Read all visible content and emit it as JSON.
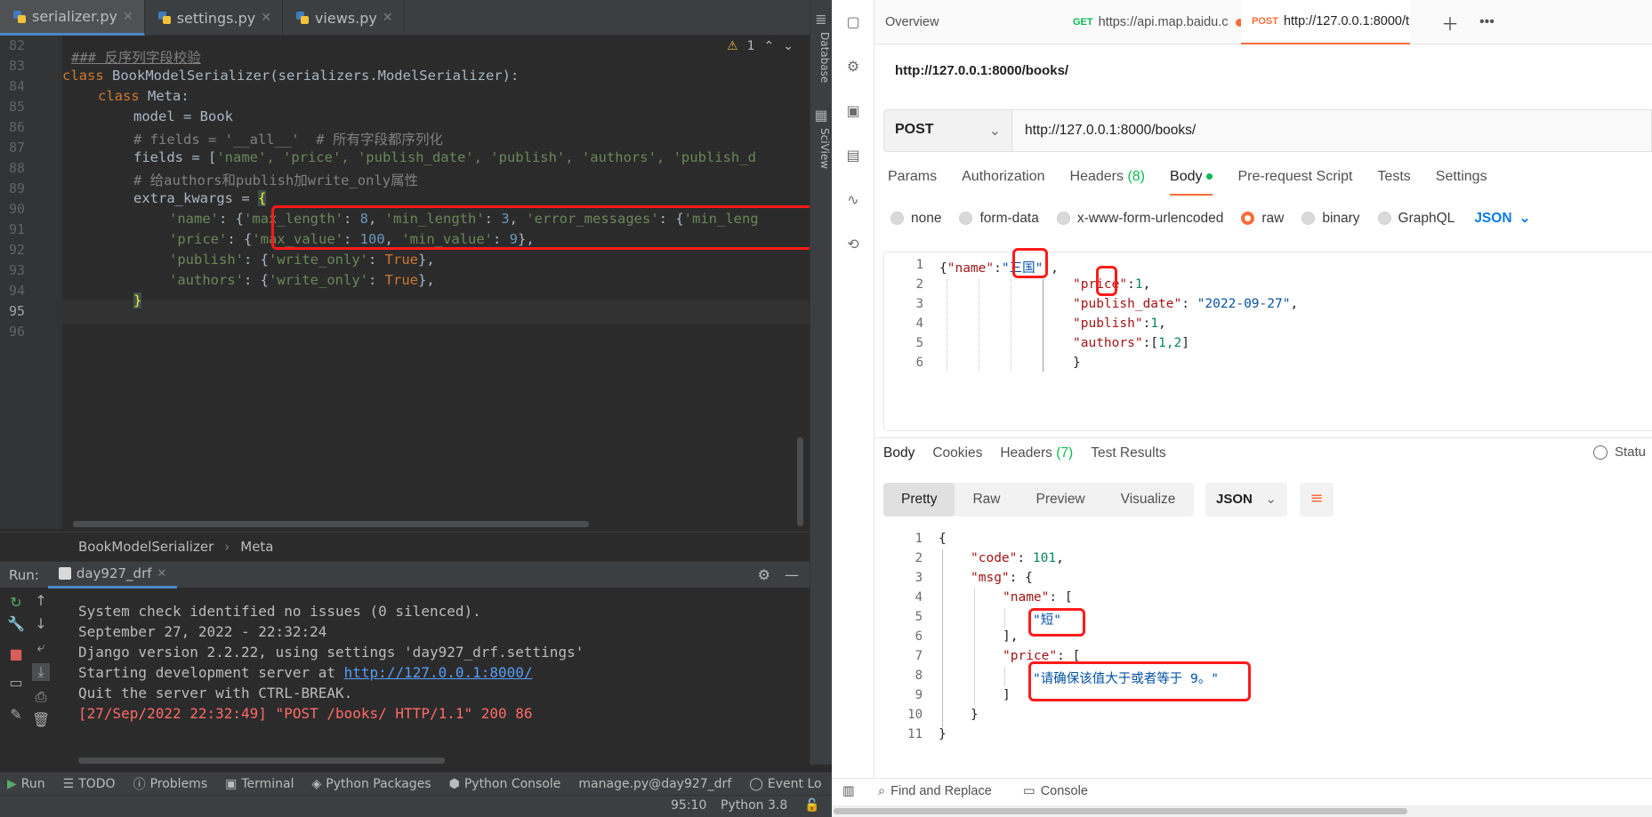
{
  "ide": {
    "tabs": [
      {
        "label": "serializer.py"
      },
      {
        "label": "settings.py"
      },
      {
        "label": "views.py"
      }
    ],
    "tool_windows": {
      "database": "Database",
      "sciview": "SciView"
    },
    "inspection": {
      "warnings": "1"
    },
    "line_numbers": [
      "82",
      "83",
      "84",
      "85",
      "86",
      "87",
      "88",
      "89",
      "90",
      "91",
      "92",
      "93",
      "94",
      "95",
      "96"
    ],
    "code": {
      "l83_comment": "### 反序列字段校验",
      "l84_kw": "class",
      "l84_name": "BookModelSerializer",
      "l84_rest": "(serializers.ModelSerializer):",
      "l85_kw": "class",
      "l85_name": " Meta:",
      "l86": "model = Book",
      "l87": "# fields = '__all__'  # 所有字段都序列化",
      "l88_a": "fields = [",
      "l88_b": "'name', 'price', 'publish_date', 'publish', 'authors', 'publish_d",
      "l89": "# 给authors和publish加write_only属性",
      "l90_a": "extra_kwargs = ",
      "l90_b": "{",
      "l91_a": "'name'",
      "l91_b": ": {",
      "l91_c": "'max_length'",
      "l91_d": ": ",
      "l91_e": "8",
      "l91_f": ", ",
      "l91_g": "'min_length'",
      "l91_h": ": ",
      "l91_i": "3",
      "l91_j": ", ",
      "l91_k": "'error_messages'",
      "l91_l": ": {",
      "l91_m": "'min_leng",
      "l92_a": "'price'",
      "l92_b": ": {",
      "l92_c": "'max_value'",
      "l92_d": ": ",
      "l92_e": "100",
      "l92_f": ", ",
      "l92_g": "'min_value'",
      "l92_h": ": ",
      "l92_i": "9",
      "l92_j": "},",
      "l93_a": "'publish'",
      "l93_b": ": {",
      "l93_c": "'write_only'",
      "l93_d": ": ",
      "l93_e": "True",
      "l93_f": "},",
      "l94_a": "'authors'",
      "l94_b": ": {",
      "l94_c": "'write_only'",
      "l94_d": ": ",
      "l94_e": "True",
      "l94_f": "},",
      "l95": "}"
    },
    "breadcrumb": [
      "BookModelSerializer",
      "Meta"
    ],
    "run": {
      "label": "Run:",
      "config": "day927_drf",
      "console": [
        "System check identified no issues (0 silenced).",
        "September 27, 2022 - 22:32:24",
        "Django version 2.2.22, using settings 'day927_drf.settings'",
        "Starting development server at ",
        "Quit the server with CTRL-BREAK.",
        "[27/Sep/2022 22:32:49] \"POST /books/ HTTP/1.1\" 200 86"
      ],
      "server_link": "http://127.0.0.1:8000/"
    },
    "bottom_tools": [
      "Run",
      "TODO",
      "Problems",
      "Terminal",
      "Python Packages",
      "Python Console",
      "manage.py@day927_drf",
      "Event Lo"
    ],
    "status": {
      "position": "95:10",
      "interpreter": "Python 3.8"
    }
  },
  "postman": {
    "tabs": {
      "overview": "Overview",
      "get_method": "GET",
      "get_url": "https://api.map.baidu.c",
      "post_method": "POST",
      "post_url": "http://127.0.0.1:8000/t"
    },
    "request_title": "http://127.0.0.1:8000/books/",
    "method": "POST",
    "url": "http://127.0.0.1:8000/books/",
    "request_tabs": {
      "params": "Params",
      "auth": "Authorization",
      "headers": "Headers",
      "headers_count": "(8)",
      "body": "Body",
      "prerequest": "Pre-request Script",
      "tests": "Tests",
      "settings": "Settings"
    },
    "body_options": [
      "none",
      "form-data",
      "x-www-form-urlencoded",
      "raw",
      "binary",
      "GraphQL"
    ],
    "body_format": "JSON",
    "request_lines": [
      "1",
      "2",
      "3",
      "4",
      "5",
      "6"
    ],
    "request_body": {
      "l1_open": "{",
      "l1_key": "\"name\"",
      "l1_colon": ":",
      "l1_val": "\"三国\"",
      "l1_comma": ",",
      "l2_key": "\"price\"",
      "l2_colon": ":",
      "l2_val": "1",
      "l2_comma": ",",
      "l3_key": "\"publish_date\"",
      "l3_colon": ": ",
      "l3_val": "\"2022-09-27\"",
      "l3_comma": ",",
      "l4_key": "\"publish\"",
      "l4_colon": ":",
      "l4_val": "1",
      "l4_comma": ",",
      "l5_key": "\"authors\"",
      "l5_colon": ":[",
      "l5_val": "1,2",
      "l5_close": "]",
      "l6": "}"
    },
    "response_tabs": {
      "body": "Body",
      "cookies": "Cookies",
      "headers": "Headers",
      "headers_count": "(7)",
      "tests": "Test Results"
    },
    "status_label": "Statu",
    "view_modes": [
      "Pretty",
      "Raw",
      "Preview",
      "Visualize"
    ],
    "response_format": "JSON",
    "response_lines": [
      "1",
      "2",
      "3",
      "4",
      "5",
      "6",
      "7",
      "8",
      "9",
      "10",
      "11"
    ],
    "response_body": {
      "l1": "{",
      "l2_key": "\"code\"",
      "l2_colon": ": ",
      "l2_val": "101",
      "l2_comma": ",",
      "l3_key": "\"msg\"",
      "l3_rest": ": {",
      "l4_key": "\"name\"",
      "l4_rest": ": [",
      "l5_val": "\"短\"",
      "l6": "],",
      "l7_key": "\"price\"",
      "l7_rest": ": [",
      "l8_val": "\"请确保该值大于或者等于 9。\"",
      "l9": "]",
      "l10": "}",
      "l11": "}"
    },
    "footer": {
      "find": "Find and Replace",
      "console": "Console"
    }
  },
  "colors": {
    "highlight_box": "#ff1a1a",
    "postman_accent": "#ff6c37",
    "ide_background": "#2b2b2b"
  }
}
